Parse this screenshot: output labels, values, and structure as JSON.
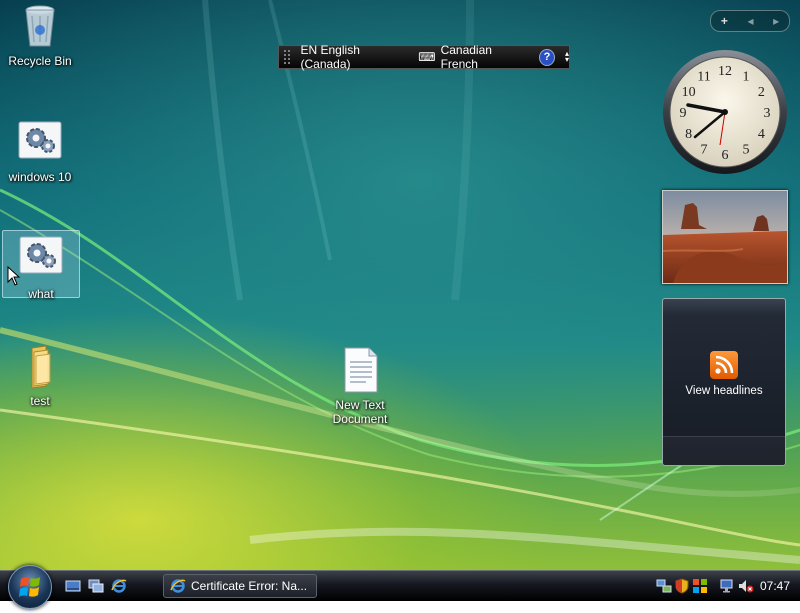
{
  "desktop": {
    "icons": [
      {
        "label": "Recycle Bin"
      },
      {
        "label": "windows 10"
      },
      {
        "label": "what"
      },
      {
        "label": "test"
      },
      {
        "label": "New Text Document"
      }
    ]
  },
  "language_bar": {
    "language": "EN English (Canada)",
    "keyboard": "Canadian French",
    "help": "?"
  },
  "sidebar": {
    "add_button": "+",
    "prev": "◂",
    "next": "▸",
    "feed_label": "View headlines",
    "clock": {
      "hours": [
        12,
        1,
        2,
        3,
        4,
        5,
        6,
        7,
        8,
        9,
        10,
        11
      ]
    }
  },
  "taskbar": {
    "windows": [
      {
        "label": "Certificate Error: Na..."
      }
    ],
    "time": "07:47"
  },
  "icons": [
    "recycle-bin-icon",
    "settings-icon",
    "folder-icon",
    "text-document-icon",
    "rss-icon",
    "internet-explorer-icon",
    "show-desktop-icon",
    "switch-windows-icon",
    "volume-muted-icon",
    "network-icon",
    "security-shield-icon"
  ]
}
